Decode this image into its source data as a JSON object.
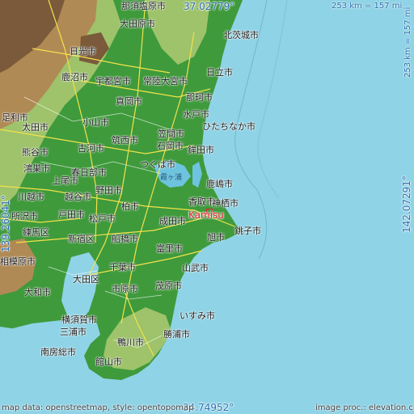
{
  "map": {
    "colors": {
      "sea": "#8fd3e6",
      "lowland": "#3f9a3c",
      "midland": "#9ec36a",
      "highland": "#b08a55",
      "mountain": "#7a5a3a",
      "lake": "#6ec3df",
      "marker": "#e0202a",
      "coord_text": "#2a6fb0"
    },
    "coords": {
      "top": "37.02779°",
      "bottom": "34.74952°",
      "left": "139.26041°",
      "right": "142.07291°"
    },
    "scale": {
      "horizontal": "253 km = 157 mi",
      "vertical": "253 km = 157 mi"
    },
    "credits": {
      "left": "map data: openstreetmap, style: opentopomap",
      "right": "image proc.: elevation.city"
    },
    "marker": {
      "label": "Kamisu"
    },
    "cities": [
      "那須塩原市",
      "大田原市",
      "北茨城市",
      "日光市",
      "日立市",
      "鹿沼市",
      "宇都宮市",
      "常陸大宮市",
      "那珂市",
      "真岡市",
      "水戸市",
      "足利市",
      "太田市",
      "小山市",
      "笠間市",
      "ひたちなか市",
      "熊谷市",
      "古河市",
      "筑西市",
      "石岡市",
      "鉾田市",
      "鴻巣市",
      "つくば市",
      "上尾市",
      "春日部市",
      "鹿嶋市",
      "野田市",
      "川越市",
      "越谷市",
      "柏市",
      "香取市",
      "神栖市",
      "所沢市",
      "戸田市",
      "松戸市",
      "成田市",
      "銚子市",
      "練馬区",
      "新宿区",
      "船橋市",
      "旭市",
      "相模原市",
      "大田区",
      "千葉市",
      "富里市",
      "山武市",
      "市原市",
      "茂原市",
      "大和市",
      "横須賀市",
      "いすみ市",
      "三浦市",
      "勝浦市",
      "鴨川市",
      "南房総市",
      "館山市",
      "霞ヶ浦"
    ]
  }
}
